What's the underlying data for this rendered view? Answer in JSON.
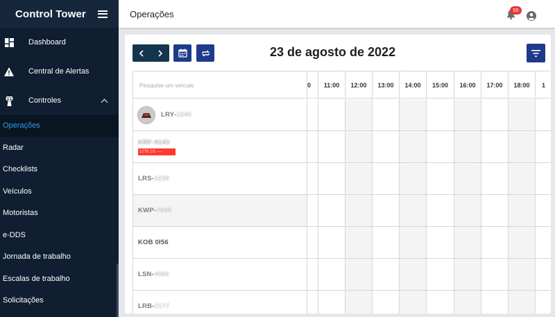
{
  "sidebar": {
    "brand": "Control Tower",
    "main_items": [
      {
        "label": "Dashboard",
        "icon": "dashboard-icon"
      },
      {
        "label": "Central de Alertas",
        "icon": "warning-icon"
      },
      {
        "label": "Controles",
        "icon": "tower-icon",
        "expanded": true
      }
    ],
    "sub_items": [
      {
        "label": "Operações",
        "active": true
      },
      {
        "label": "Radar"
      },
      {
        "label": "Checklists"
      },
      {
        "label": "Veículos"
      },
      {
        "label": "Motoristas"
      },
      {
        "label": "e-DDS"
      },
      {
        "label": "Jornada de trabalho"
      },
      {
        "label": "Escalas de trabalho"
      },
      {
        "label": "Solicitações"
      }
    ]
  },
  "header": {
    "title": "Operações",
    "notifications_count": "55"
  },
  "toolbar": {
    "date": "23 de agosto de 2022"
  },
  "grid": {
    "search_placeholder": "Pesquise um veículo",
    "hours": [
      "0",
      "11:00",
      "12:00",
      "13:00",
      "14:00",
      "15:00",
      "16:00",
      "17:00",
      "18:00",
      "1"
    ],
    "vehicles": [
      {
        "prefix": "LRY-",
        "rest": "2240",
        "avatar": true
      },
      {
        "prefix": "",
        "rest": "KRF-9143",
        "tag": "1276 1/1 ----"
      },
      {
        "prefix": "LRS-",
        "rest": "3239"
      },
      {
        "prefix": "KWP-",
        "rest": "7549"
      },
      {
        "prefix": "KOB 0I56",
        "rest": ""
      },
      {
        "prefix": "LSN-",
        "rest": "4066"
      },
      {
        "prefix": "LRB-",
        "rest": "2177"
      }
    ]
  },
  "colors": {
    "sidebar_bg": "#0f1e30",
    "active_link": "#2f9cf4",
    "primary_button": "#1d3b8a",
    "nav_button": "#13364e",
    "badge": "#e53935",
    "alert_tag": "#ff3b2f"
  }
}
